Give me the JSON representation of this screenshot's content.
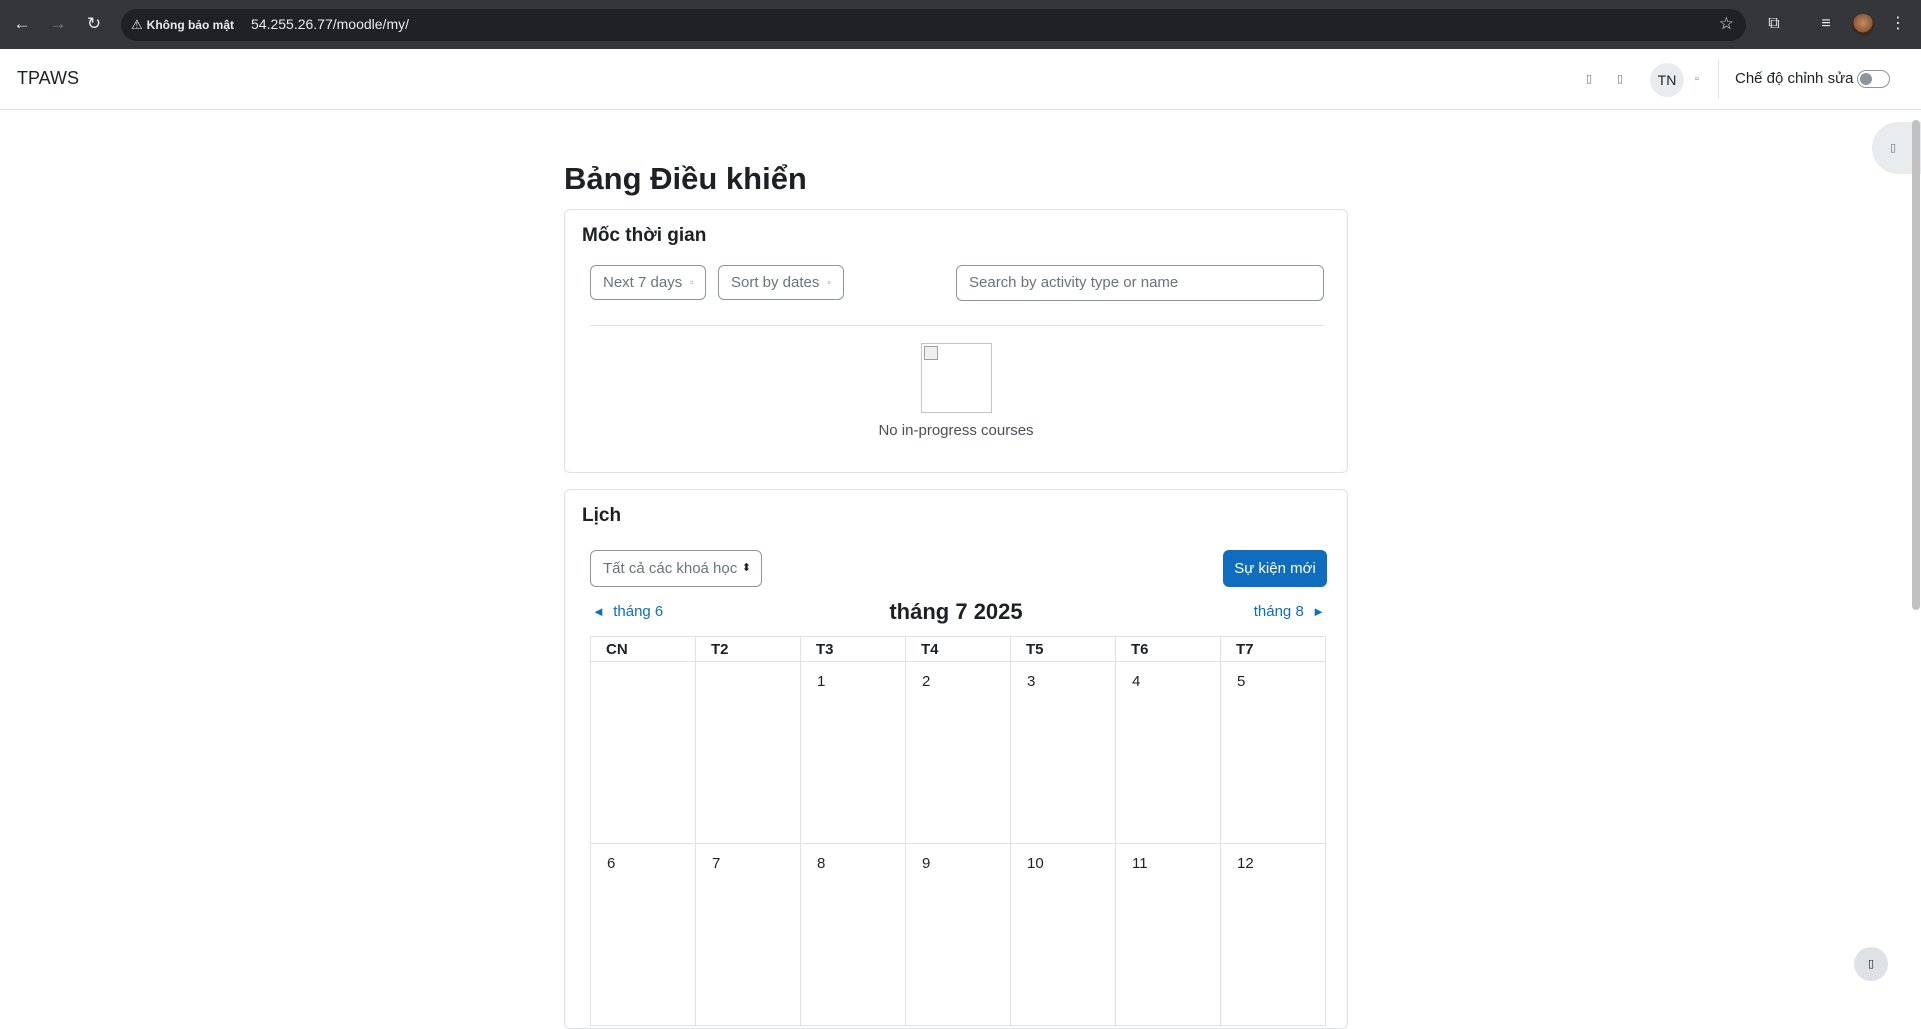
{
  "browser": {
    "security_label": "Không bảo mật",
    "url": "54.255.26.77/moodle/my/"
  },
  "header": {
    "brand": "TPAWS",
    "avatar_initials": "TN",
    "edit_mode_label": "Chế độ chỉnh sửa",
    "edit_mode_on": false
  },
  "page": {
    "title": "Bảng Điều khiển"
  },
  "timeline": {
    "title": "Mốc thời gian",
    "filter_label": "Next 7 days",
    "sort_label": "Sort by dates",
    "search_placeholder": "Search by activity type or name",
    "empty_text": "No in-progress courses"
  },
  "calendar": {
    "title": "Lịch",
    "course_filter": "Tất cả các khoá học",
    "new_event_label": "Sự kiện mới",
    "prev_month": "tháng 6",
    "current_month": "tháng 7 2025",
    "next_month": "tháng 8",
    "weekdays": [
      "CN",
      "T2",
      "T3",
      "T4",
      "T5",
      "T6",
      "T7"
    ],
    "weeks": [
      [
        "",
        "",
        "1",
        "2",
        "3",
        "4",
        "5"
      ],
      [
        "6",
        "7",
        "8",
        "9",
        "10",
        "11",
        "12"
      ]
    ]
  },
  "colors": {
    "primary": "#0f6cbf",
    "border": "#dee2e6",
    "chrome_bg": "#35363a"
  }
}
